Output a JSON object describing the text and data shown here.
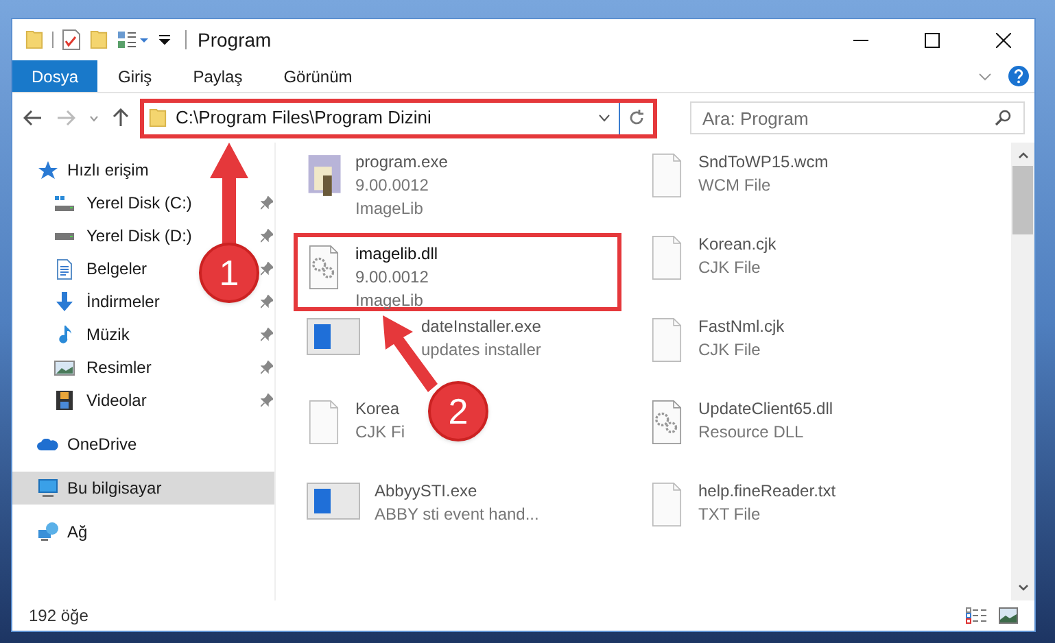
{
  "window": {
    "title": "Program"
  },
  "ribbon_tabs": [
    {
      "label": "Dosya",
      "selected": true
    },
    {
      "label": "Giriş",
      "selected": false
    },
    {
      "label": "Paylaş",
      "selected": false
    },
    {
      "label": "Görünüm",
      "selected": false
    }
  ],
  "address": {
    "value": "C:\\Program Files\\Program Dizini"
  },
  "search": {
    "placeholder": "Ara: Program"
  },
  "sidebar": {
    "items": [
      {
        "label": "Hızlı erişim",
        "selected": false,
        "children": [
          {
            "label": "Yerel Disk (C:)",
            "pinned": true
          },
          {
            "label": "Yerel Disk (D:)",
            "pinned": true
          },
          {
            "label": "Belgeler",
            "pinned": true
          },
          {
            "label": "İndirmeler",
            "pinned": true
          },
          {
            "label": "Müzik",
            "pinned": true
          },
          {
            "label": "Resimler",
            "pinned": true
          },
          {
            "label": "Videolar",
            "pinned": true
          }
        ]
      },
      {
        "label": "OneDrive",
        "selected": false
      },
      {
        "label": "Bu bilgisayar",
        "selected": true
      },
      {
        "label": "Ağ",
        "selected": false
      }
    ]
  },
  "files": [
    {
      "kind": "program",
      "name": "program.exe",
      "lines": [
        "9.00.0012",
        "ImageLib"
      ],
      "faded": true,
      "highlighted": false
    },
    {
      "kind": "file",
      "name": "SndToWP15.wcm",
      "lines": [
        "WCM File"
      ],
      "faded": true,
      "highlighted": false
    },
    {
      "kind": "gear",
      "name": "imagelib.dll",
      "lines": [
        "9.00.0012",
        "ImageLib"
      ],
      "faded": false,
      "highlighted": true
    },
    {
      "kind": "file",
      "name": "Korean.cjk",
      "lines": [
        "CJK File"
      ],
      "faded": true,
      "highlighted": false
    },
    {
      "kind": "app",
      "name": "dateInstaller.exe",
      "lines": [
        "updates installer"
      ],
      "faded": true,
      "highlighted": false
    },
    {
      "kind": "file",
      "name": "FastNml.cjk",
      "lines": [
        "CJK File"
      ],
      "faded": true,
      "highlighted": false
    },
    {
      "kind": "file",
      "name": "Korea",
      "lines": [
        "CJK Fi"
      ],
      "faded": true,
      "highlighted": false
    },
    {
      "kind": "gear",
      "name": "UpdateClient65.dll",
      "lines": [
        "Resource DLL"
      ],
      "faded": true,
      "highlighted": false
    },
    {
      "kind": "app",
      "name": "AbbyySTI.exe",
      "lines": [
        "ABBY sti event hand..."
      ],
      "faded": true,
      "highlighted": false
    },
    {
      "kind": "file",
      "name": "help.fineReader.txt",
      "lines": [
        "TXT File"
      ],
      "faded": true,
      "highlighted": false
    }
  ],
  "status_bar": {
    "count": "192 öğe"
  },
  "callouts": [
    "1",
    "2"
  ]
}
